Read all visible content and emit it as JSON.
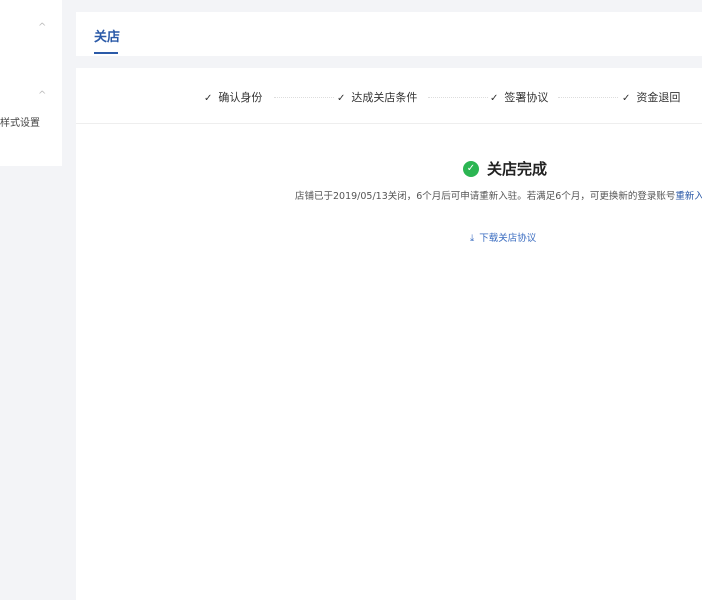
{
  "sidebar": {
    "item": "样式设置"
  },
  "header": {
    "tab": "关店"
  },
  "steps": [
    "确认身份",
    "达成关店条件",
    "签署协议",
    "资金退回"
  ],
  "result": {
    "title": "关店完成",
    "description": "店铺已于2019/05/13关闭，6个月后可申请重新入驻。若满足6个月，可更换新的登录账号",
    "link": "重新入驻",
    "download": "下载关店协议"
  },
  "colors": {
    "accent": "#2b5aa8",
    "success": "#2bb552"
  }
}
